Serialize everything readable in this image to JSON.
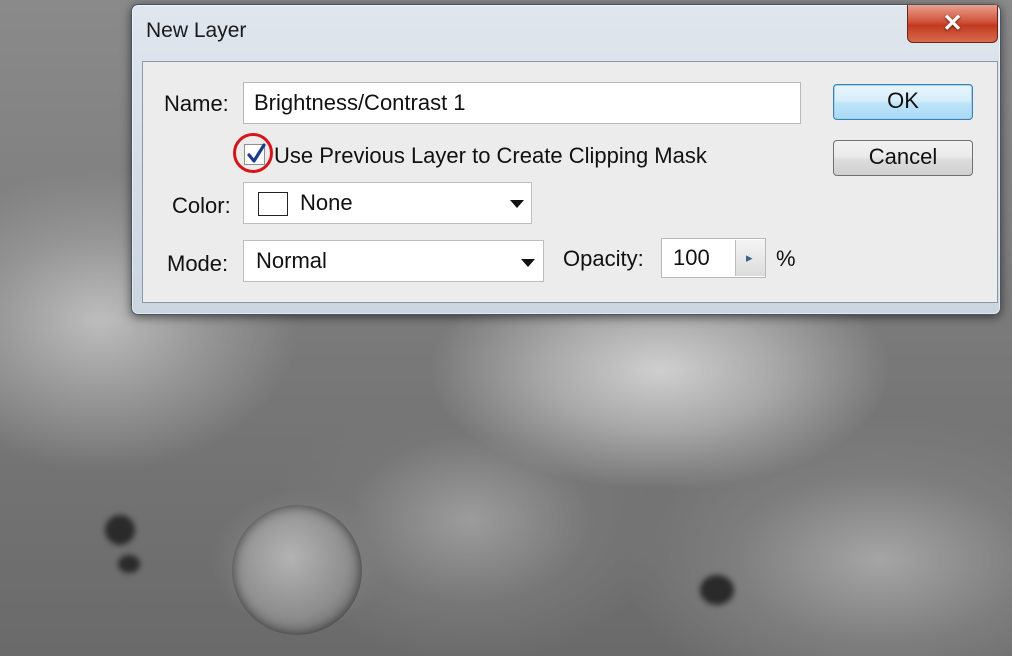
{
  "dialog": {
    "title": "New Layer",
    "close_glyph": "✕",
    "name_label": "Name:",
    "name_value": "Brightness/Contrast 1",
    "clipping_checkbox_label": "Use Previous Layer to Create Clipping Mask",
    "clipping_checked": true,
    "color_label": "Color:",
    "color_value": "None",
    "mode_label": "Mode:",
    "mode_value": "Normal",
    "opacity_label": "Opacity:",
    "opacity_value": "100",
    "opacity_unit": "%",
    "ok_label": "OK",
    "cancel_label": "Cancel"
  },
  "icons": {
    "close": "close-icon",
    "checkmark": "checkmark-icon",
    "dropdown": "chevron-down-icon",
    "spin": "chevron-right-icon"
  },
  "colors": {
    "highlight_ring": "#d7141a",
    "ok_border": "#3c7fb1",
    "close_button": "#c03a21"
  }
}
